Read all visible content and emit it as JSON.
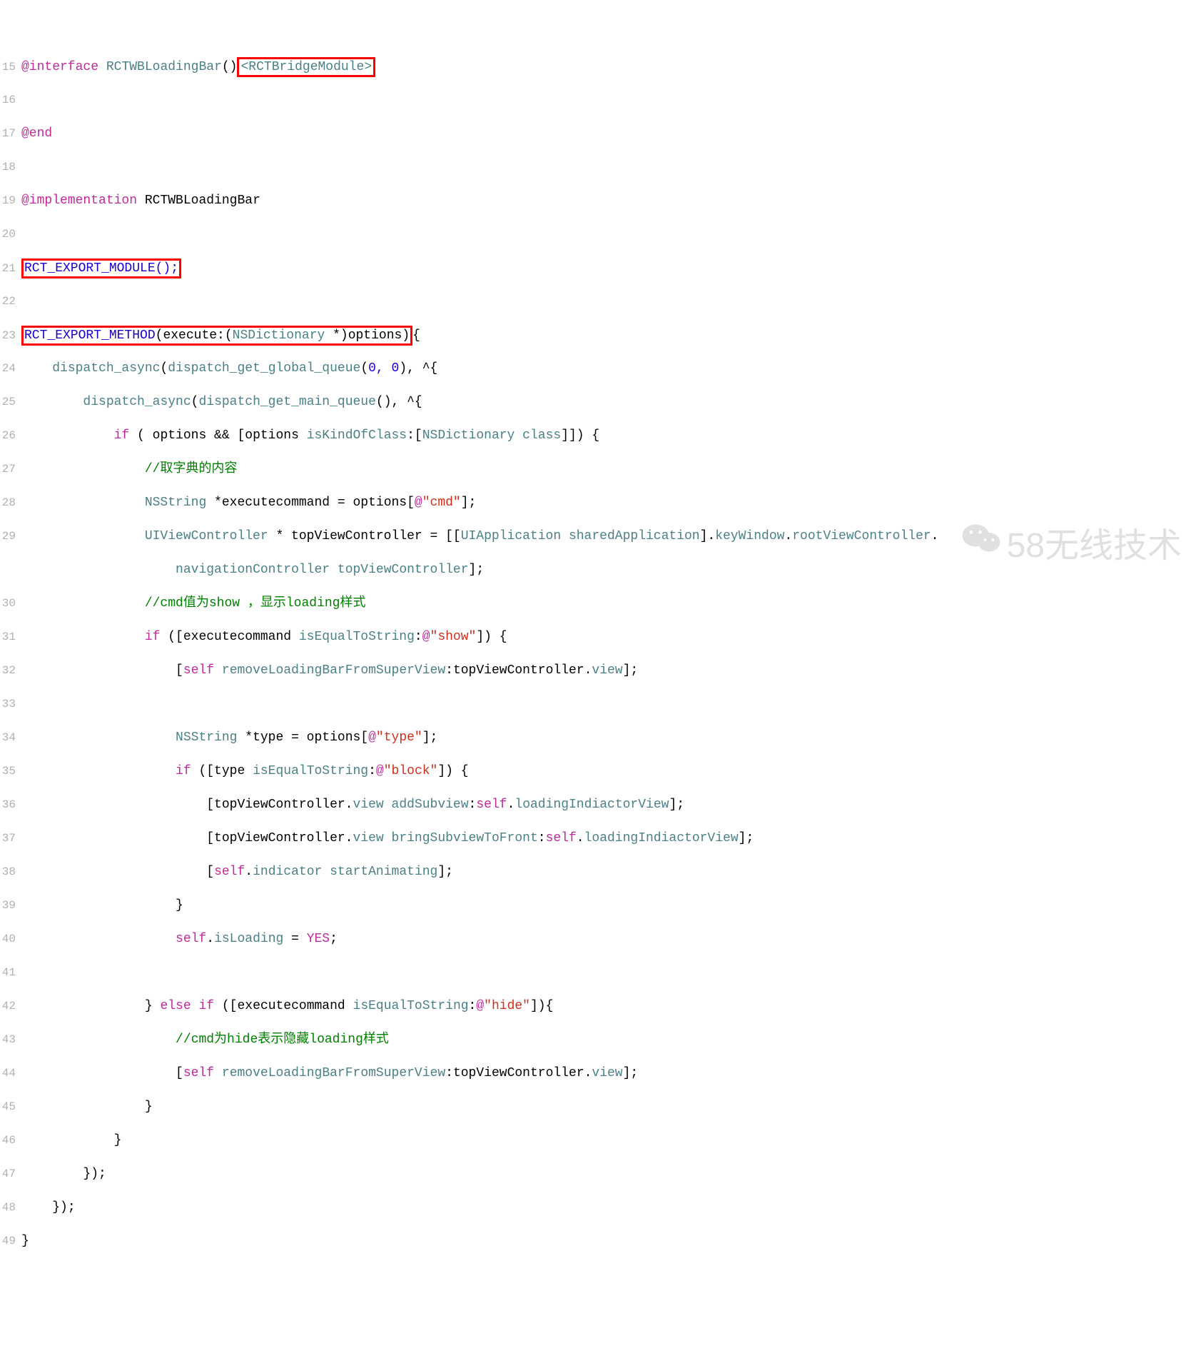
{
  "watermark": "58无线技术",
  "line_numbers": [
    "15",
    "16",
    "17",
    "18",
    "19",
    "20",
    "21",
    "22",
    "23",
    "24",
    "25",
    "26",
    "27",
    "28",
    "29",
    "",
    "30",
    "31",
    "32",
    "33",
    "34",
    "35",
    "36",
    "37",
    "38",
    "39",
    "40",
    "41",
    "42",
    "43",
    "44",
    "45",
    "46",
    "47",
    "48",
    "49"
  ],
  "tokens": {
    "at_interface": "@interface",
    "at_end": "@end",
    "at_implementation": "@implementation",
    "class_name": "RCTWBLoadingBar",
    "protocol": "<RCTBridgeModule>",
    "rct_export_module": "RCT_EXPORT_MODULE();",
    "rct_export_method_head": "RCT_EXPORT_METHOD",
    "execute_sig_open": "(execute:(",
    "nsdictionary": "NSDictionary",
    "execute_sig_close": " *)options)",
    "brace_open": "{",
    "l24_a": "dispatch_async",
    "l24_b": "dispatch_get_global_queue",
    "l24_nums": "0, 0",
    "l24_tail": "), ^{",
    "l25_a": "dispatch_async",
    "l25_b": "dispatch_get_main_queue",
    "l25_tail": "(), ^{",
    "l26_if": "if",
    "l26_mid1": " ( options && [options ",
    "l26_isKind": "isKindOfClass",
    "l26_mid2": ":[",
    "l26_nsdict": "NSDictionary",
    "l26_mid3": " ",
    "l26_class": "class",
    "l26_tail": "]]) {",
    "l27_comment": "//取字典的内容",
    "l28_nsstring": "NSString",
    "l28_mid": " *executecommand = options[",
    "l28_at": "@",
    "l28_str": "\"cmd\"",
    "l28_tail": "];",
    "l29_uivc": "UIViewController",
    "l29_mid1": " * topViewController = [[",
    "l29_uiapp": "UIApplication",
    "l29_mid2": " ",
    "l29_shared": "sharedApplication",
    "l29_mid3": "].",
    "l29_keywin": "keyWindow",
    "l29_mid4": ".",
    "l29_rootvc": "rootViewController",
    "l29_dot": ".",
    "l29b_nav": "navigationController",
    "l29b_mid": " ",
    "l29b_top": "topViewController",
    "l29b_tail": "];",
    "l30_comment": "//cmd值为show ，显示loading样式",
    "l31_if": "if",
    "l31_mid1": " ([executecommand ",
    "l31_iseq": "isEqualToString",
    "l31_mid2": ":",
    "l31_at": "@",
    "l31_str": "\"show\"",
    "l31_tail": "]) {",
    "l32_self": "self",
    "l32_open": "[",
    "l32_mid1": " ",
    "l32_remove": "removeLoadingBarFromSuperView",
    "l32_mid2": ":topViewController.",
    "l32_view": "view",
    "l32_tail": "];",
    "l34_nsstring": "NSString",
    "l34_mid": " *type = options[",
    "l34_at": "@",
    "l34_str": "\"type\"",
    "l34_tail": "];",
    "l35_if": "if",
    "l35_mid1": " ([type ",
    "l35_iseq": "isEqualToString",
    "l35_mid2": ":",
    "l35_at": "@",
    "l35_str": "\"block\"",
    "l35_tail": "]) {",
    "l36_open": "[topViewController.",
    "l36_view": "view",
    "l36_mid": " ",
    "l36_add": "addSubview",
    "l36_mid2": ":",
    "l36_self": "self",
    "l36_mid3": ".",
    "l36_load": "loadingIndiactorView",
    "l36_tail": "];",
    "l37_open": "[topViewController.",
    "l37_view": "view",
    "l37_mid": " ",
    "l37_bring": "bringSubviewToFront",
    "l37_mid2": ":",
    "l37_self": "self",
    "l37_mid3": ".",
    "l37_load": "loadingIndiactorView",
    "l37_tail": "];",
    "l38_open": "[",
    "l38_self": "self",
    "l38_mid": ".",
    "l38_ind": "indicator",
    "l38_mid2": " ",
    "l38_start": "startAnimating",
    "l38_tail": "];",
    "l39_close": "}",
    "l40_self": "self",
    "l40_mid": ".",
    "l40_isload": "isLoading",
    "l40_eq": " = ",
    "l40_yes": "YES",
    "l40_tail": ";",
    "l42_close": "} ",
    "l42_else": "else",
    "l42_mid0": " ",
    "l42_if": "if",
    "l42_mid1": " ([executecommand ",
    "l42_iseq": "isEqualToString",
    "l42_mid2": ":",
    "l42_at": "@",
    "l42_str": "\"hide\"",
    "l42_tail": "]){",
    "l43_comment": "//cmd为hide表示隐藏loading样式",
    "l44_open": "[",
    "l44_self": "self",
    "l44_mid1": " ",
    "l44_remove": "removeLoadingBarFromSuperView",
    "l44_mid2": ":topViewController.",
    "l44_view": "view",
    "l44_tail": "];",
    "l45_close": "}",
    "l46_close": "}",
    "l47_close": "});",
    "l48_close": "});",
    "l49_close": "}"
  }
}
